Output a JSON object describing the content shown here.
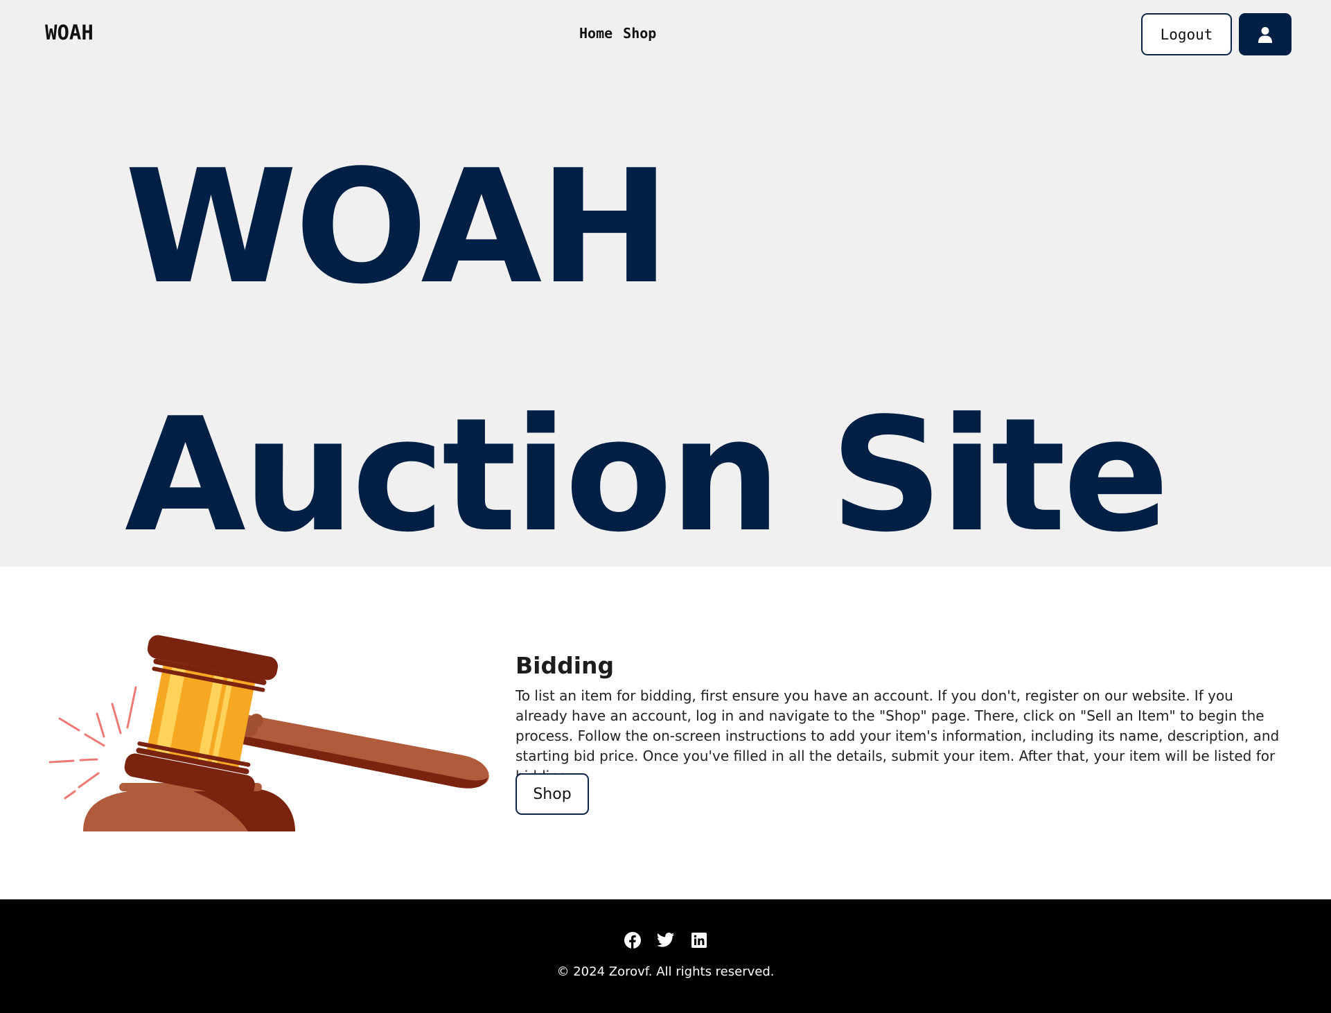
{
  "nav": {
    "brand": "WOAH",
    "links": [
      "Home",
      "Shop"
    ],
    "logout_label": "Logout",
    "user_icon": "user-icon"
  },
  "hero": {
    "line1": "WOAH",
    "line2": "Auction Site"
  },
  "bidding": {
    "title": "Bidding",
    "text": "To list an item for bidding, first ensure you have an account. If you don't, register on our website. If you already have an account, log in and navigate to the \"Shop\" page. There, click on \"Sell an Item\" to begin the process. Follow the on-screen instructions to add your item's information, including its name, description, and starting bid price. Once you've filled in all the details, submit your item. After that, your item will be listed for bidding.",
    "button_label": "Shop",
    "image": "gavel-illustration"
  },
  "footer": {
    "social_icons": [
      "facebook-icon",
      "twitter-icon",
      "linkedin-icon"
    ],
    "copyright": "© 2024 Zorovf. All rights reserved."
  },
  "colors": {
    "navy": "#001f44",
    "hero_bg": "#f0f0f0",
    "footer_bg": "#000000"
  }
}
